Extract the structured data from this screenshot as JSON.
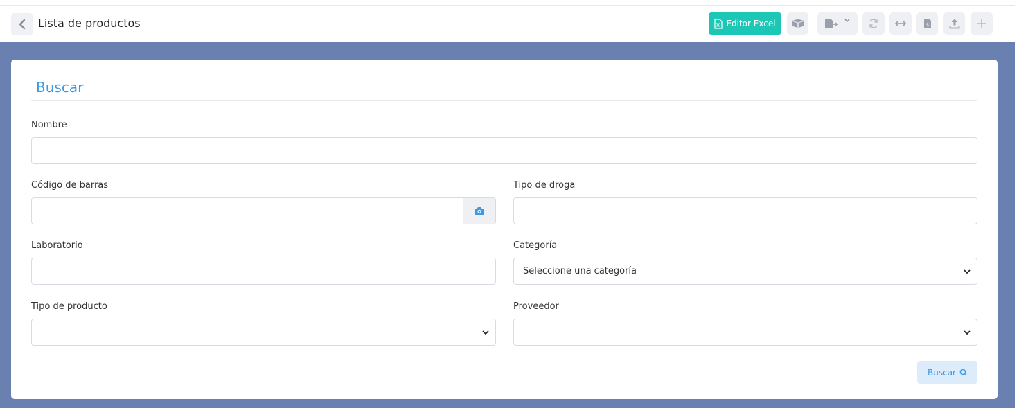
{
  "header": {
    "title": "Lista de productos",
    "excel_button": "Editor Excel"
  },
  "form": {
    "title": "Buscar",
    "nombre": {
      "label": "Nombre",
      "value": ""
    },
    "codigo_barras": {
      "label": "Código de barras",
      "value": ""
    },
    "tipo_droga": {
      "label": "Tipo de droga",
      "value": ""
    },
    "laboratorio": {
      "label": "Laboratorio",
      "value": ""
    },
    "categoria": {
      "label": "Categoría",
      "selected": "Seleccione una categoría"
    },
    "tipo_producto": {
      "label": "Tipo de producto",
      "selected": ""
    },
    "proveedor": {
      "label": "Proveedor",
      "selected": ""
    },
    "search_button": "Buscar"
  },
  "colors": {
    "accent": "#3b9ae6",
    "excel": "#1cc7b6",
    "background": "#6a80b0"
  }
}
